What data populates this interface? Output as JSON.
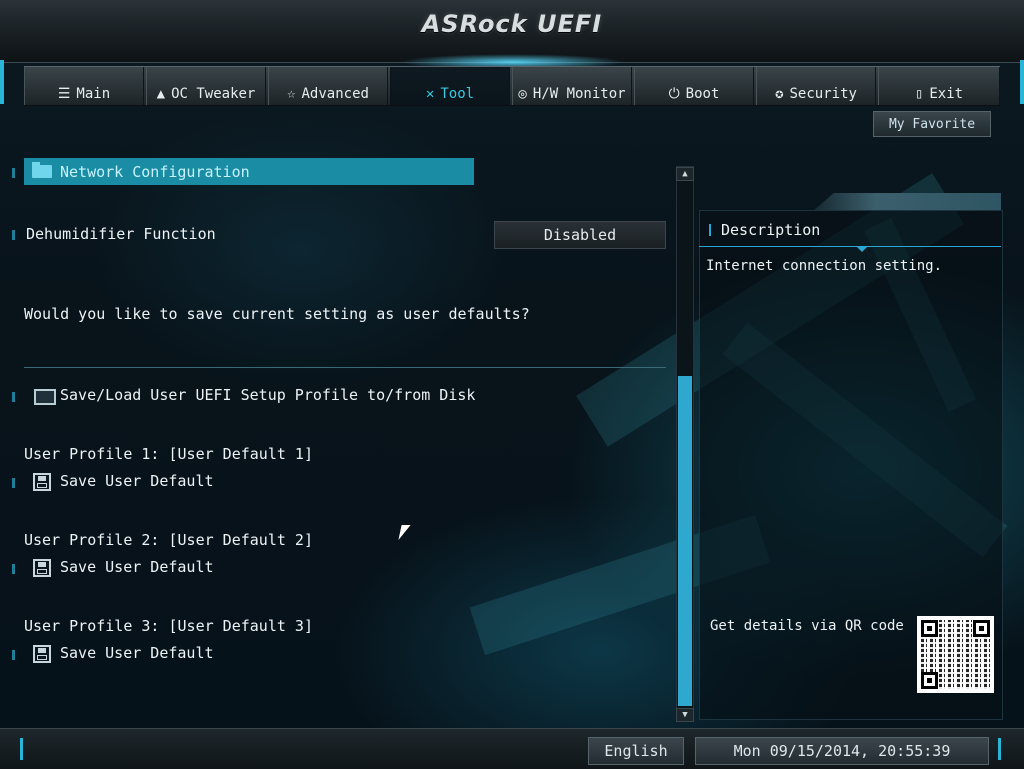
{
  "header": {
    "logo": "ASRock UEFI"
  },
  "tabs": [
    {
      "label": "Main",
      "icon": "list-icon",
      "glyph": "☰"
    },
    {
      "label": "OC Tweaker",
      "icon": "rocket-icon",
      "glyph": "▲"
    },
    {
      "label": "Advanced",
      "icon": "star-icon",
      "glyph": "☆"
    },
    {
      "label": "Tool",
      "icon": "tools-icon",
      "glyph": "✕",
      "active": true
    },
    {
      "label": "H/W Monitor",
      "icon": "monitor-gauge-icon",
      "glyph": "◎"
    },
    {
      "label": "Boot",
      "icon": "power-icon",
      "glyph": "⏻"
    },
    {
      "label": "Security",
      "icon": "shield-icon",
      "glyph": "✪"
    },
    {
      "label": "Exit",
      "icon": "door-exit-icon",
      "glyph": "▯"
    }
  ],
  "favorite_button": "My Favorite",
  "main": {
    "network_config": "Network Configuration",
    "dehumidifier_label": "Dehumidifier Function",
    "dehumidifier_value": "Disabled",
    "save_prompt": "Would you like to save current setting as user defaults?",
    "profile_disk": "Save/Load User UEFI Setup Profile to/from Disk",
    "profiles": [
      {
        "title": "User Profile 1: [User Default 1]",
        "action": "Save User Default"
      },
      {
        "title": "User Profile 2: [User Default 2]",
        "action": "Save User Default"
      },
      {
        "title": "User Profile 3: [User Default 3]",
        "action": "Save User Default"
      }
    ]
  },
  "description": {
    "title": "Description",
    "text": "Internet connection setting.",
    "qr_label": "Get details via QR code"
  },
  "footer": {
    "language": "English",
    "datetime": "Mon 09/15/2014, 20:55:39"
  },
  "scrollbar": {
    "up_glyph": "▲",
    "down_glyph": "▼"
  },
  "colors": {
    "accent": "#2ab5d6",
    "highlight": "#1a8ca3",
    "active_tab_text": "#35c8e0"
  }
}
